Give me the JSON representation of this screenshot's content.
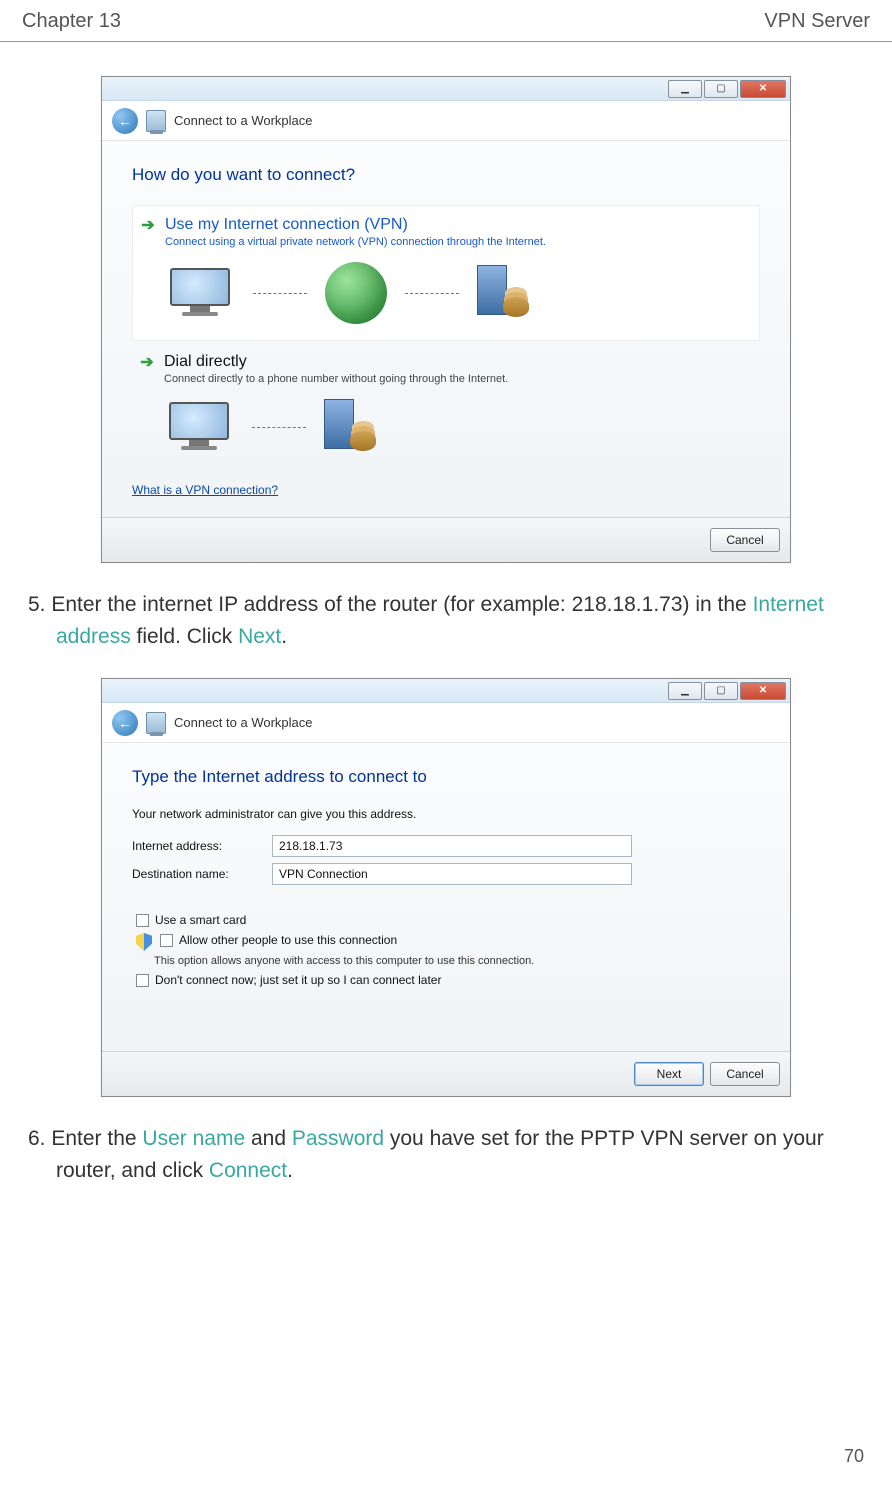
{
  "header": {
    "left": "Chapter 13",
    "right": "VPN Server"
  },
  "footer": {
    "page": "70"
  },
  "dialog1": {
    "nav_title": "Connect to a Workplace",
    "heading": "How do you want to connect?",
    "opt1_title": "Use my Internet connection (VPN)",
    "opt1_sub": "Connect using a virtual private network (VPN) connection through the Internet.",
    "opt2_title": "Dial directly",
    "opt2_sub": "Connect directly to a phone number without going through the Internet.",
    "help_link": "What is a VPN connection?",
    "cancel": "Cancel"
  },
  "step5": {
    "num": "5.",
    "t1": "Enter the internet IP address of the router (for example: 218.18.1.73) in the ",
    "teal1": "Internet",
    "teal2": "address",
    "t2": " field. Click ",
    "teal3": "Next",
    "t3": "."
  },
  "dialog2": {
    "nav_title": "Connect to a Workplace",
    "heading": "Type the Internet address to connect to",
    "hint": "Your network administrator can give you this address.",
    "label_addr": "Internet address:",
    "value_addr": "218.18.1.73",
    "label_dest": "Destination name:",
    "value_dest": "VPN Connection",
    "chk_smart": "Use a smart card",
    "chk_allow": "Allow other people to use this connection",
    "chk_allow_sub": "This option allows anyone with access to this computer to use this connection.",
    "chk_later": "Don't connect now; just set it up so I can connect later",
    "next": "Next",
    "cancel": "Cancel"
  },
  "step6": {
    "num": "6.",
    "t1": "Enter the ",
    "teal1": "User name",
    "t2": " and ",
    "teal2": "Password",
    "t3": " you have set for the PPTP VPN server on your",
    "t4": "router, and click ",
    "teal3": "Connect",
    "t5": "."
  }
}
